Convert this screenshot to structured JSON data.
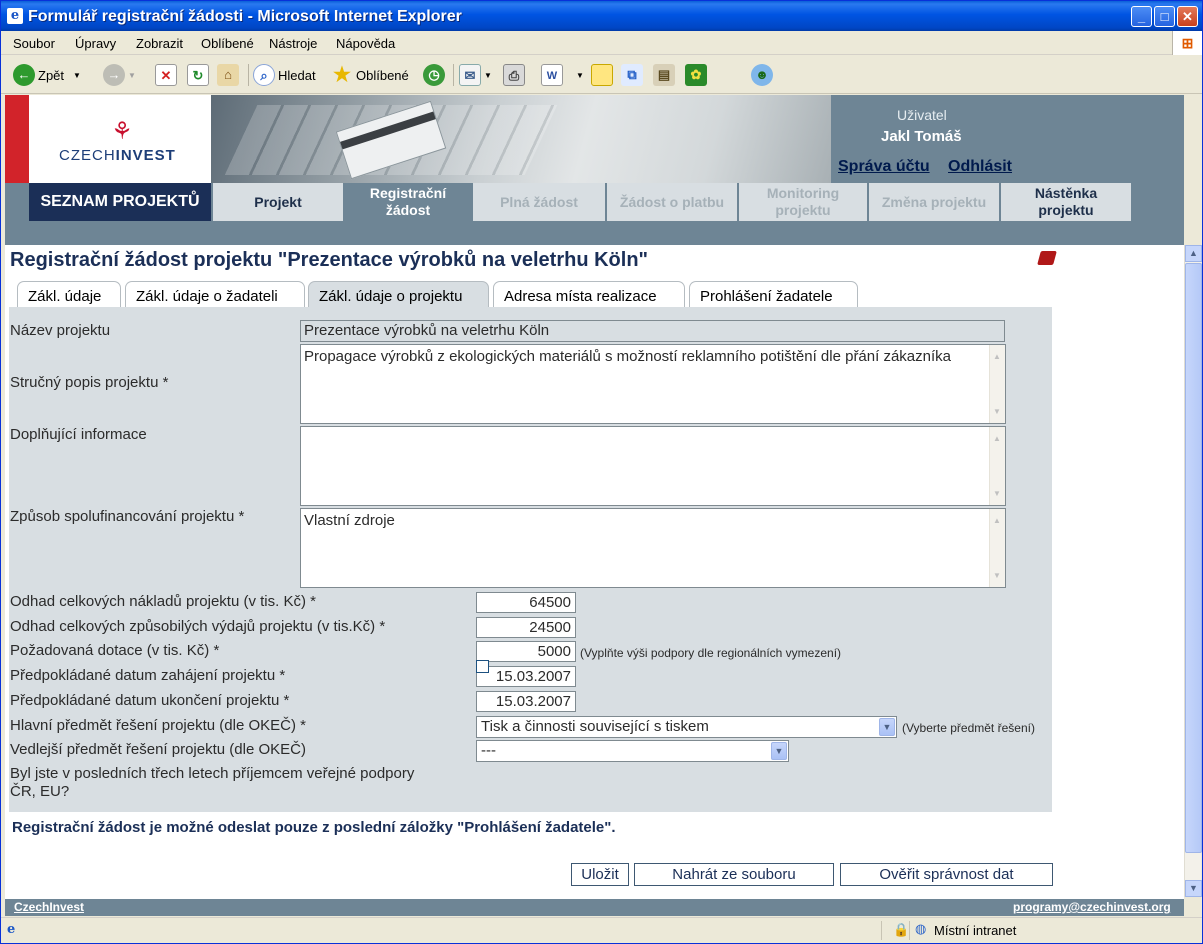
{
  "window": {
    "title": "Formulář registrační žádosti - Microsoft Internet Explorer",
    "buttons": {
      "minimize": "_",
      "maximize": "□",
      "close": "✕"
    }
  },
  "menu": [
    "Soubor",
    "Úpravy",
    "Zobrazit",
    "Oblíbené",
    "Nástroje",
    "Nápověda"
  ],
  "toolbar": {
    "back": "Zpět",
    "search": "Hledat",
    "favorites": "Oblíbené"
  },
  "header": {
    "logo_text_pre": "CZECH",
    "logo_text_bold": "INVEST",
    "user_label": "Uživatel",
    "user_name": "Jakl Tomáš",
    "account_link": "Správa účtu",
    "logout_link": "Odhlásit"
  },
  "nav": {
    "list_label": "SEZNAM PROJEKTŮ",
    "items": [
      "Projekt",
      "Registrační\nžádost",
      "Plná žádost",
      "Žádost o platbu",
      "Monitoring\nprojektu",
      "Změna projektu",
      "Nástěnka\nprojektu"
    ]
  },
  "page": {
    "title": "Registrační žádost projektu \"Prezentace výrobků na veletrhu Köln\""
  },
  "tabs": [
    "Zákl. údaje",
    "Zákl. údaje o žadateli",
    "Zákl. údaje o projektu",
    "Adresa místa realizace",
    "Prohlášení žadatele"
  ],
  "form": {
    "name_label": "Název projektu",
    "name_value": "Prezentace výrobků na veletrhu Köln",
    "desc_label": "Stručný popis projektu *",
    "desc_value": "Propagace výrobků z ekologických materiálů s možností reklamního potištění dle přání zákazníka",
    "extra_label": "Doplňující informace",
    "extra_value": "",
    "cofin_label": "Způsob spolufinancování projektu *",
    "cofin_value": "Vlastní zdroje",
    "cost_label": "Odhad celkových nákladů projektu (v tis. Kč) *",
    "cost_value": "64500",
    "eligible_label": "Odhad celkových způsobilých výdajů projektu (v tis.Kč) *",
    "eligible_value": "24500",
    "grant_label": "Požadovaná dotace (v tis. Kč) *",
    "grant_value": "5000",
    "grant_hint": "(Vyplňte výši podpory dle regionálních vymezení)",
    "start_label": "Předpokládané datum zahájení projektu *",
    "start_value": "15.03.2007",
    "end_label": "Předpokládané datum ukončení projektu *",
    "end_value": "15.03.2007",
    "main_subject_label": "Hlavní předmět řešení projektu (dle OKEČ) *",
    "main_subject_value": "Tisk a činnosti související s tiskem",
    "main_subject_hint": "(Vyberte předmět řešení)",
    "side_subject_label": "Vedlejší předmět řešení projektu (dle OKEČ)",
    "side_subject_value": "---",
    "support_label_1": "Byl jste v posledních třech letech příjemcem veřejné podpory",
    "support_label_2": "ČR, EU?"
  },
  "notice": "Registrační žádost je možné odeslat pouze z poslední záložky \"Prohlášení žadatele\".",
  "buttons": {
    "save": "Uložit",
    "load": "Nahrát ze souboru",
    "validate": "Ověřit správnost dat"
  },
  "footer": {
    "left": "CzechInvest",
    "right": "programy@czechinvest.org"
  },
  "status": {
    "zone": "Místní intranet"
  }
}
